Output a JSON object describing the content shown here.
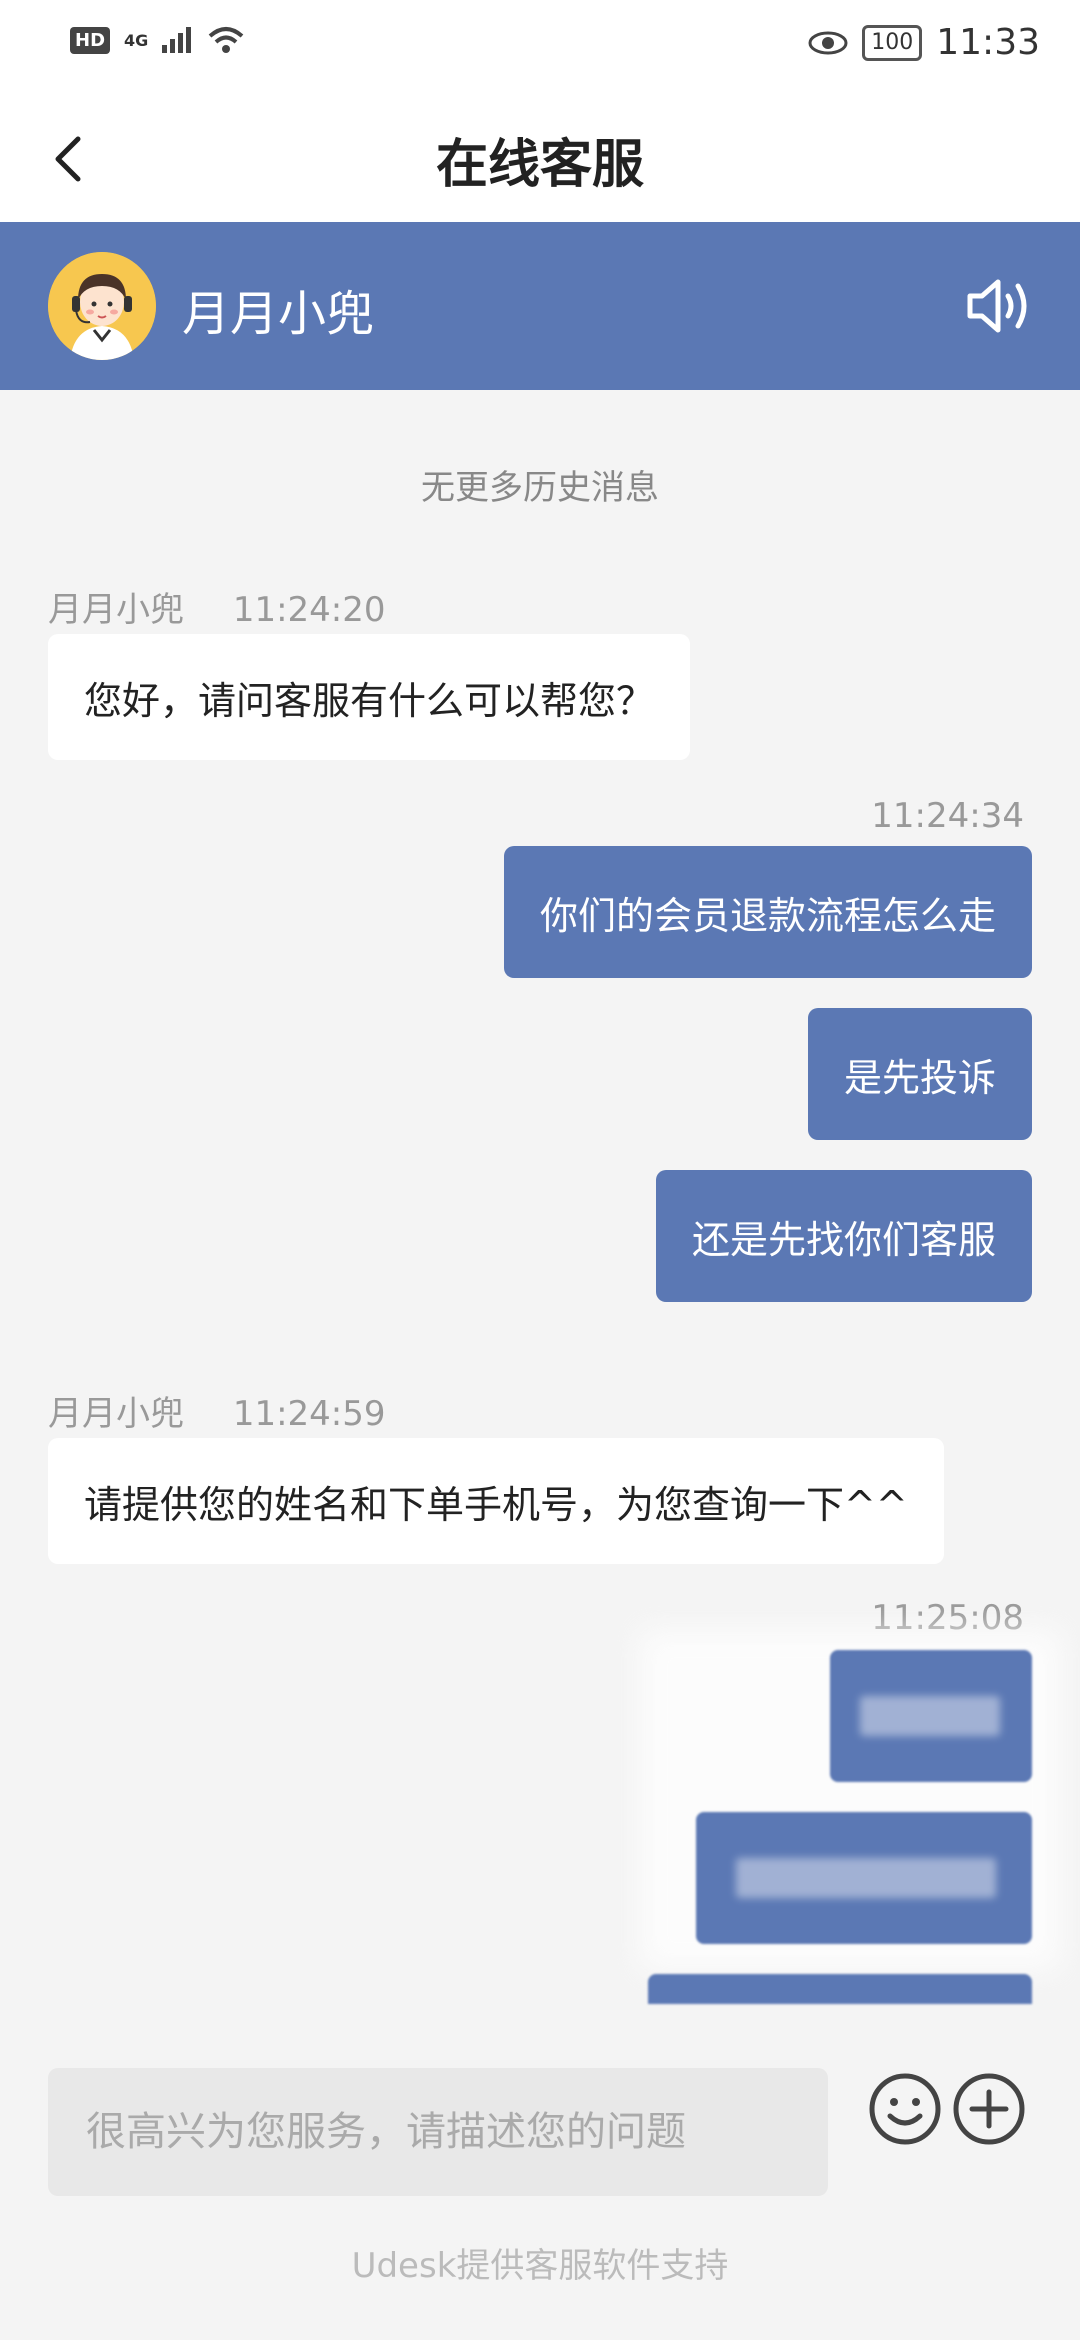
{
  "status_bar": {
    "left_badges": [
      "HD",
      "4G"
    ],
    "battery": "100",
    "time": "11:33"
  },
  "header": {
    "title": "在线客服"
  },
  "agent": {
    "name": "月月小兜"
  },
  "chat": {
    "history_note": "无更多历史消息",
    "messages": [
      {
        "side": "in",
        "sender": "月月小兜",
        "time": "11:24:20",
        "text": "您好，请问客服有什么可以帮您？"
      },
      {
        "side": "out",
        "time": "11:24:34",
        "text": "你们的会员退款流程怎么走"
      },
      {
        "side": "out",
        "text": "是先投诉"
      },
      {
        "side": "out",
        "text": "还是先找你们客服"
      },
      {
        "side": "in",
        "sender": "月月小兜",
        "time": "11:24:59",
        "text": "请提供您的姓名和下单手机号，为您查询一下^^"
      },
      {
        "side": "out",
        "time": "11:25:08",
        "text": ""
      }
    ]
  },
  "composer": {
    "placeholder": "很高兴为您服务，请描述您的问题",
    "footer": "Udesk提供客服软件支持"
  },
  "colors": {
    "accent": "#5b78b4",
    "background": "#f4f4f4"
  }
}
